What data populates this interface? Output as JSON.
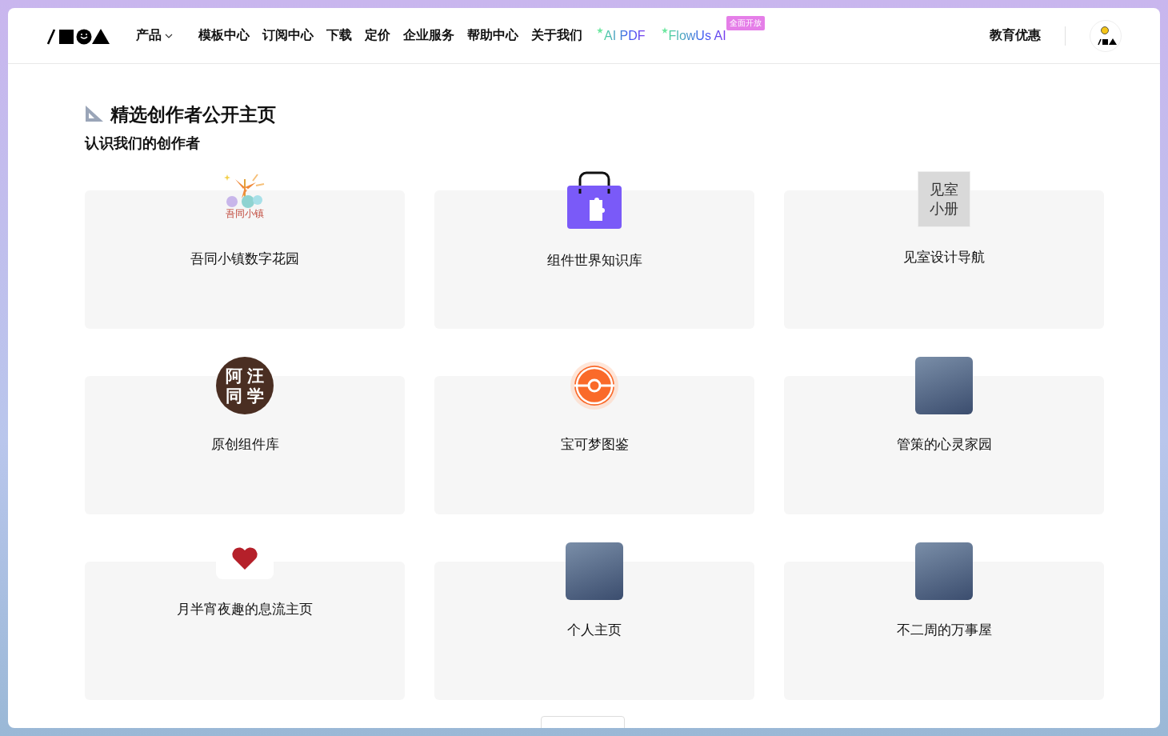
{
  "header": {
    "nav": [
      {
        "label": "产品",
        "kind": "dropdown"
      },
      {
        "label": "模板中心",
        "kind": "link"
      },
      {
        "label": "订阅中心",
        "kind": "link"
      },
      {
        "label": "下载",
        "kind": "link"
      },
      {
        "label": "定价",
        "kind": "link"
      },
      {
        "label": "企业服务",
        "kind": "link"
      },
      {
        "label": "帮助中心",
        "kind": "link"
      },
      {
        "label": "关于我们",
        "kind": "link"
      },
      {
        "label": "AI PDF",
        "kind": "ai"
      },
      {
        "label": "FlowUs AI",
        "kind": "ai",
        "badge": "全面开放"
      }
    ],
    "right_link": "教育优惠"
  },
  "section": {
    "title": "精选创作者公开主页",
    "subtitle": "认识我们的创作者"
  },
  "cards": [
    {
      "title": "吾同小镇数字花园",
      "icon": {
        "kind": "art",
        "text": "吾同小镇"
      }
    },
    {
      "title": "组件世界知识库",
      "icon": {
        "kind": "bag"
      }
    },
    {
      "title": "见室设计导航",
      "icon": {
        "kind": "tile",
        "lines": [
          "见室",
          "小册"
        ]
      }
    },
    {
      "title": "原创组件库",
      "icon": {
        "kind": "circle",
        "lines": [
          "阿汪",
          "同学"
        ]
      }
    },
    {
      "title": "宝可梦图鉴",
      "icon": {
        "kind": "ball"
      }
    },
    {
      "title": "管策的心灵家园",
      "icon": {
        "kind": "photo"
      }
    },
    {
      "title": "月半宵夜趣的息流主页",
      "icon": {
        "kind": "heart"
      }
    },
    {
      "title": "个人主页",
      "icon": {
        "kind": "photo"
      }
    },
    {
      "title": "不二周的万事屋",
      "icon": {
        "kind": "photo"
      }
    }
  ]
}
